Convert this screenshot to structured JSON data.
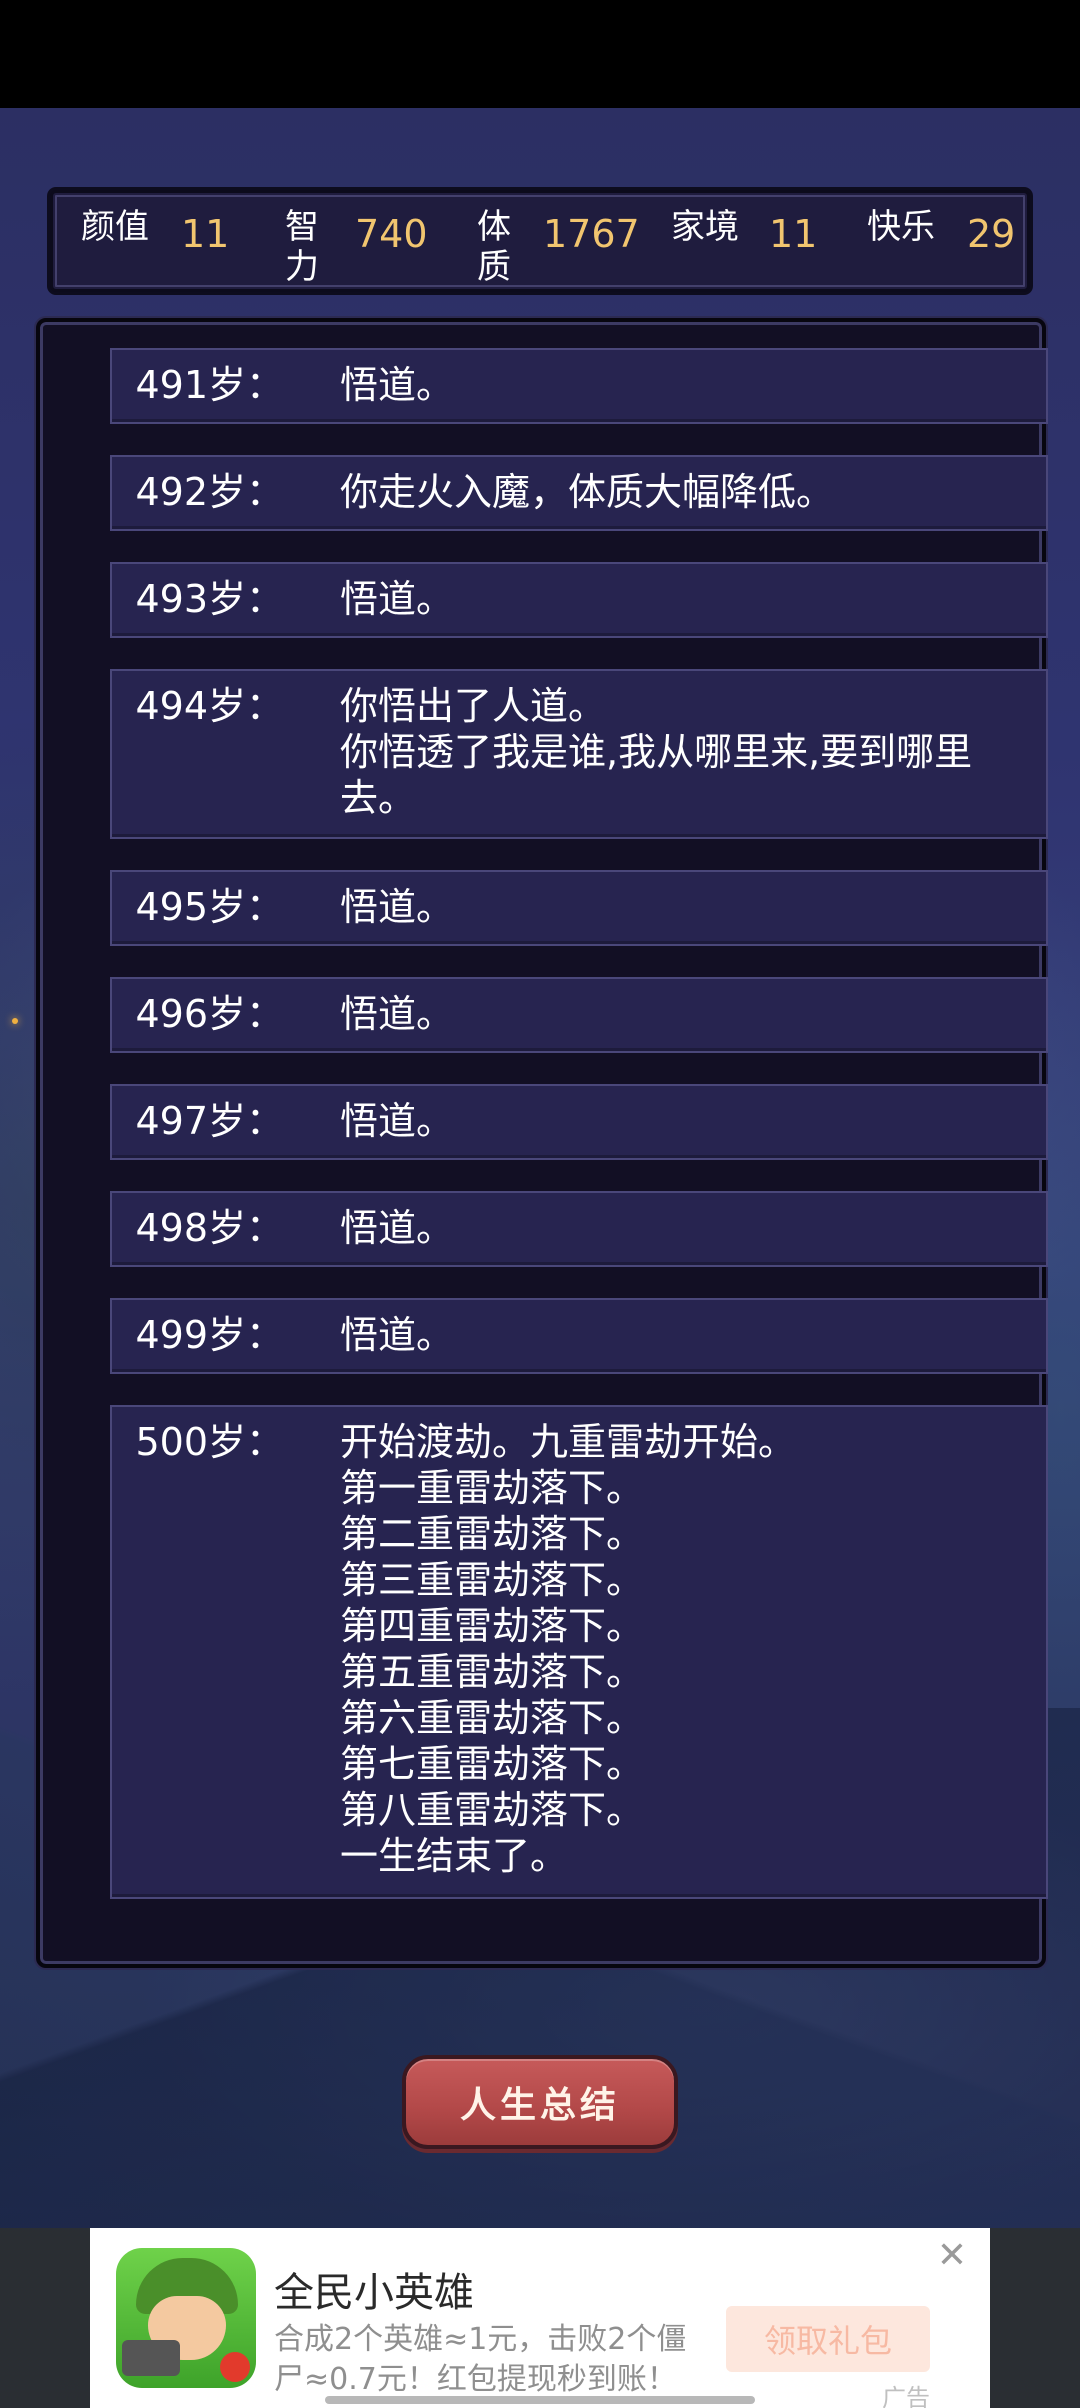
{
  "stats": [
    {
      "label": "颜值",
      "value": "11"
    },
    {
      "label": "智力",
      "value": "740"
    },
    {
      "label": "体质",
      "value": "1767"
    },
    {
      "label": "家境",
      "value": "11"
    },
    {
      "label": "快乐",
      "value": "29"
    }
  ],
  "log": [
    {
      "age": "491岁：",
      "lines": [
        "悟道。"
      ]
    },
    {
      "age": "492岁：",
      "lines": [
        "你走火入魔，体质大幅降低。"
      ]
    },
    {
      "age": "493岁：",
      "lines": [
        "悟道。"
      ]
    },
    {
      "age": "494岁：",
      "lines": [
        "你悟出了人道。",
        "你悟透了我是谁,我从哪里来,要到哪里去。"
      ]
    },
    {
      "age": "495岁：",
      "lines": [
        "悟道。"
      ]
    },
    {
      "age": "496岁：",
      "lines": [
        "悟道。"
      ]
    },
    {
      "age": "497岁：",
      "lines": [
        "悟道。"
      ]
    },
    {
      "age": "498岁：",
      "lines": [
        "悟道。"
      ]
    },
    {
      "age": "499岁：",
      "lines": [
        "悟道。"
      ]
    },
    {
      "age": "500岁：",
      "lines": [
        "开始渡劫。九重雷劫开始。",
        "第一重雷劫落下。",
        "第二重雷劫落下。",
        "第三重雷劫落下。",
        "第四重雷劫落下。",
        "第五重雷劫落下。",
        "第六重雷劫落下。",
        "第七重雷劫落下。",
        "第八重雷劫落下。",
        "一生结束了。"
      ]
    }
  ],
  "summary_button": "人生总结",
  "ad": {
    "title": "全民小英雄",
    "description": "合成2个英雄≈1元，击败2个僵尸≈0.7元！红包提现秒到账！",
    "cta": "领取礼包",
    "close": "✕",
    "mark": "广告"
  }
}
